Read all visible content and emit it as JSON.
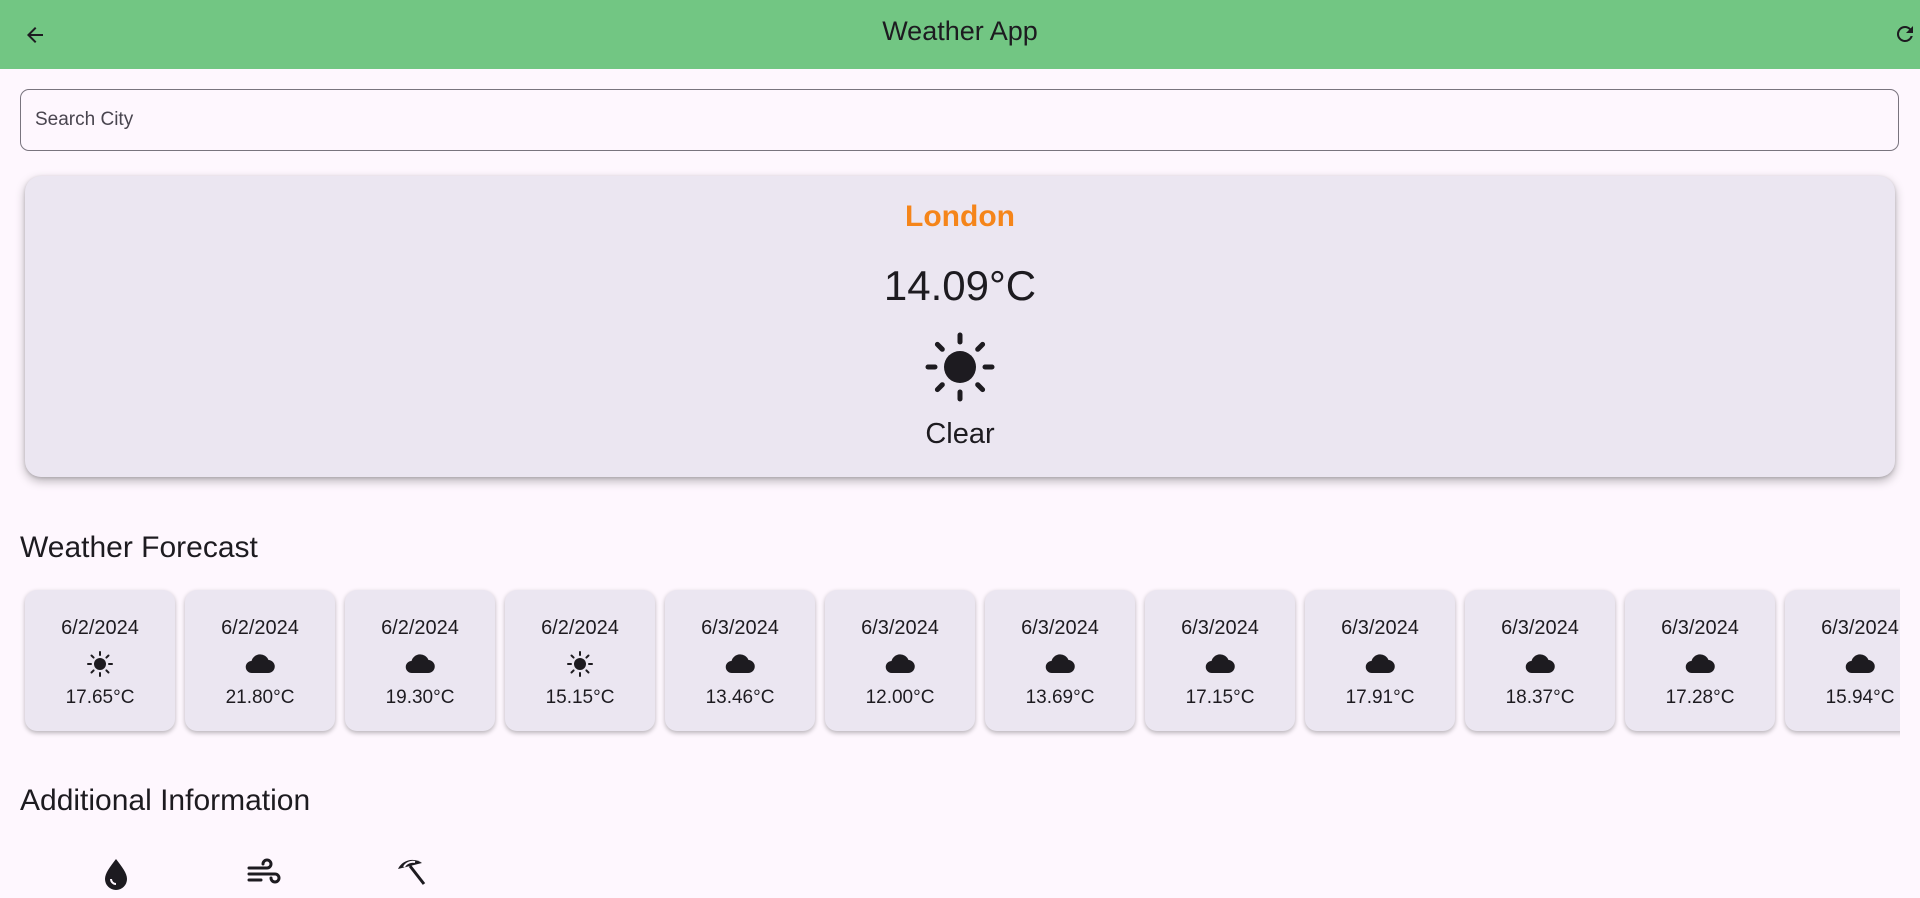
{
  "appbar": {
    "title": "Weather App",
    "back_icon": "arrow-back-icon",
    "refresh_icon": "refresh-icon",
    "color": "#72c683"
  },
  "search": {
    "placeholder": "Search City",
    "value": ""
  },
  "current": {
    "city": "London",
    "temperature": "14.09°C",
    "condition": "Clear",
    "icon": "sun-icon",
    "city_color": "#f5851a"
  },
  "forecast": {
    "title": "Weather Forecast",
    "items": [
      {
        "date": "6/2/2024",
        "icon": "sun-icon",
        "temp": "17.65°C"
      },
      {
        "date": "6/2/2024",
        "icon": "cloud-icon",
        "temp": "21.80°C"
      },
      {
        "date": "6/2/2024",
        "icon": "cloud-icon",
        "temp": "19.30°C"
      },
      {
        "date": "6/2/2024",
        "icon": "sun-icon",
        "temp": "15.15°C"
      },
      {
        "date": "6/3/2024",
        "icon": "cloud-icon",
        "temp": "13.46°C"
      },
      {
        "date": "6/3/2024",
        "icon": "cloud-icon",
        "temp": "12.00°C"
      },
      {
        "date": "6/3/2024",
        "icon": "cloud-icon",
        "temp": "13.69°C"
      },
      {
        "date": "6/3/2024",
        "icon": "cloud-icon",
        "temp": "17.15°C"
      },
      {
        "date": "6/3/2024",
        "icon": "cloud-icon",
        "temp": "17.91°C"
      },
      {
        "date": "6/3/2024",
        "icon": "cloud-icon",
        "temp": "18.37°C"
      },
      {
        "date": "6/3/2024",
        "icon": "cloud-icon",
        "temp": "17.28°C"
      },
      {
        "date": "6/3/2024",
        "icon": "cloud-icon",
        "temp": "15.94°C"
      }
    ]
  },
  "additional": {
    "title": "Additional Information",
    "icons": [
      "humidity-drop-icon",
      "wind-icon",
      "beach-umbrella-icon"
    ]
  }
}
